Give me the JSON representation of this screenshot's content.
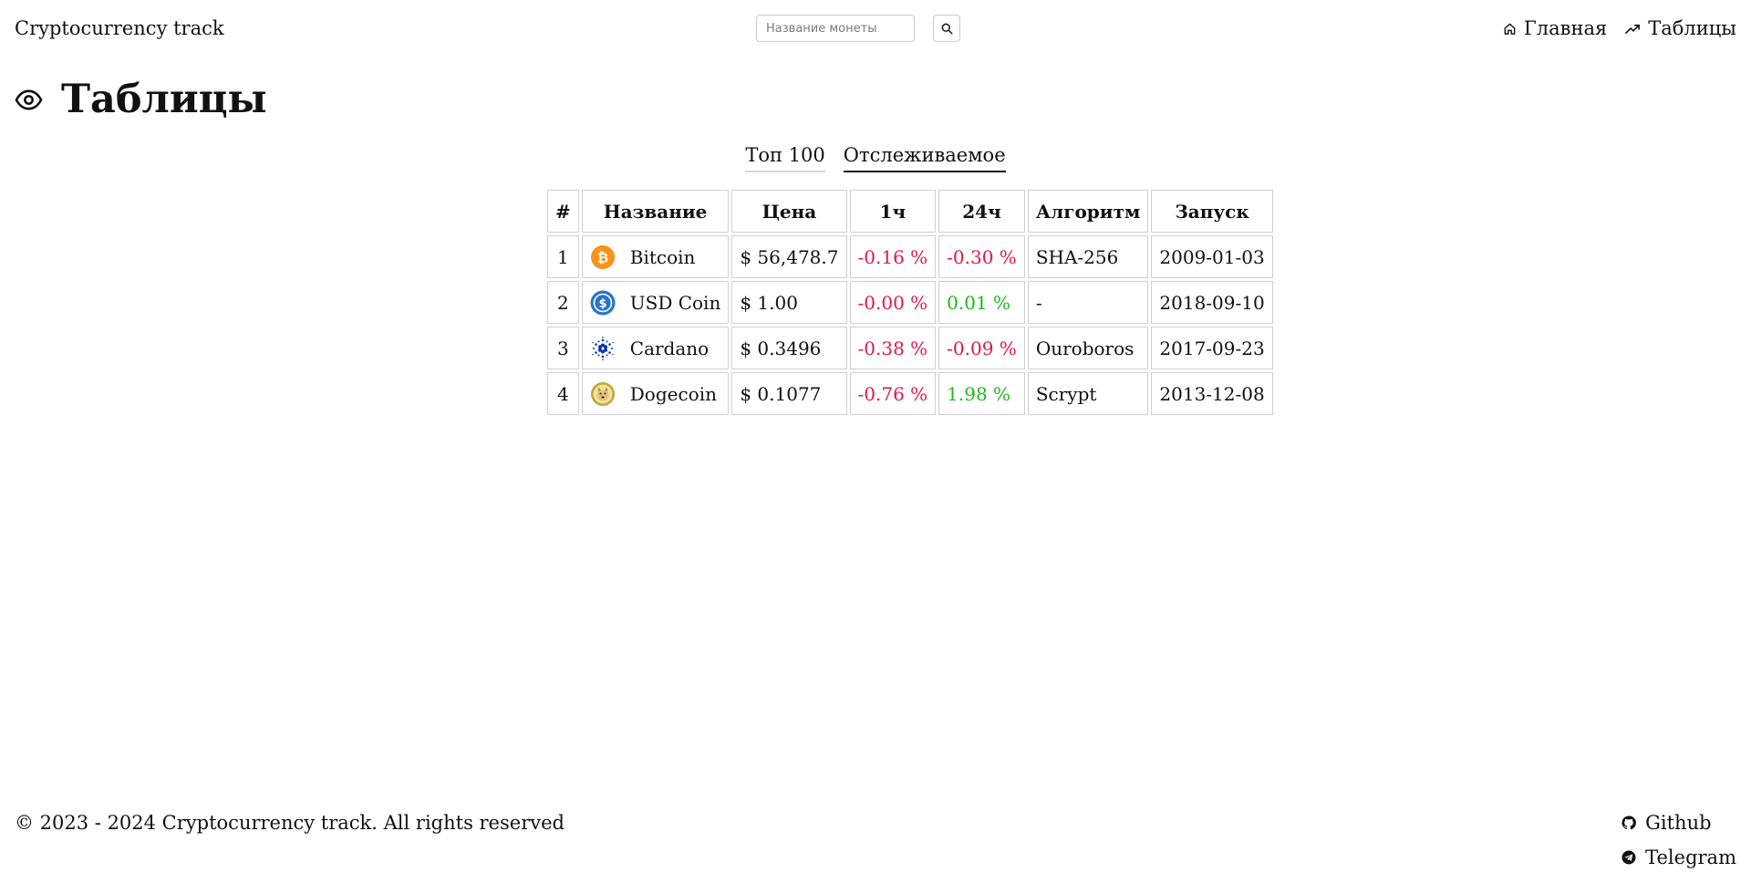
{
  "header": {
    "brand": "Cryptocurrency track",
    "search_placeholder": "Название монеты",
    "nav": [
      {
        "label": "Главная",
        "icon": "home-icon"
      },
      {
        "label": "Таблицы",
        "icon": "trending-up-icon"
      }
    ]
  },
  "page": {
    "title": "Таблицы",
    "title_icon": "eye-icon"
  },
  "tabs": [
    {
      "label": "Топ 100",
      "active": false
    },
    {
      "label": "Отслеживаемое",
      "active": true
    }
  ],
  "table": {
    "columns": [
      "#",
      "Название",
      "Цена",
      "1ч",
      "24ч",
      "Алгоритм",
      "Запуск"
    ],
    "rows": [
      {
        "rank": "1",
        "name": "Bitcoin",
        "icon": "bitcoin-icon",
        "price": "$ 56,478.7",
        "h1": "-0.16 %",
        "h24": "-0.30 %",
        "algorithm": "SHA-256",
        "launch": "2009-01-03"
      },
      {
        "rank": "2",
        "name": "USD Coin",
        "icon": "usd-coin-icon",
        "price": "$ 1.00",
        "h1": "-0.00 %",
        "h24": "0.01 %",
        "algorithm": "-",
        "launch": "2018-09-10"
      },
      {
        "rank": "3",
        "name": "Cardano",
        "icon": "cardano-icon",
        "price": "$ 0.3496",
        "h1": "-0.38 %",
        "h24": "-0.09 %",
        "algorithm": "Ouroboros",
        "launch": "2017-09-23"
      },
      {
        "rank": "4",
        "name": "Dogecoin",
        "icon": "dogecoin-icon",
        "price": "$ 0.1077",
        "h1": "-0.76 %",
        "h24": "1.98 %",
        "algorithm": "Scrypt",
        "launch": "2013-12-08"
      }
    ]
  },
  "colors": {
    "negative": "#e0184d",
    "positive": "#1fb81f",
    "bitcoin": "#f7931a",
    "usd_coin": "#2775ca",
    "cardano": "#0033ad",
    "dogecoin": "#c2a633"
  },
  "footer": {
    "copyright": "© 2023 - 2024 Cryptocurrency track. All rights reserved",
    "links": [
      {
        "label": "Github",
        "icon": "github-icon"
      },
      {
        "label": "Telegram",
        "icon": "telegram-icon"
      }
    ]
  }
}
